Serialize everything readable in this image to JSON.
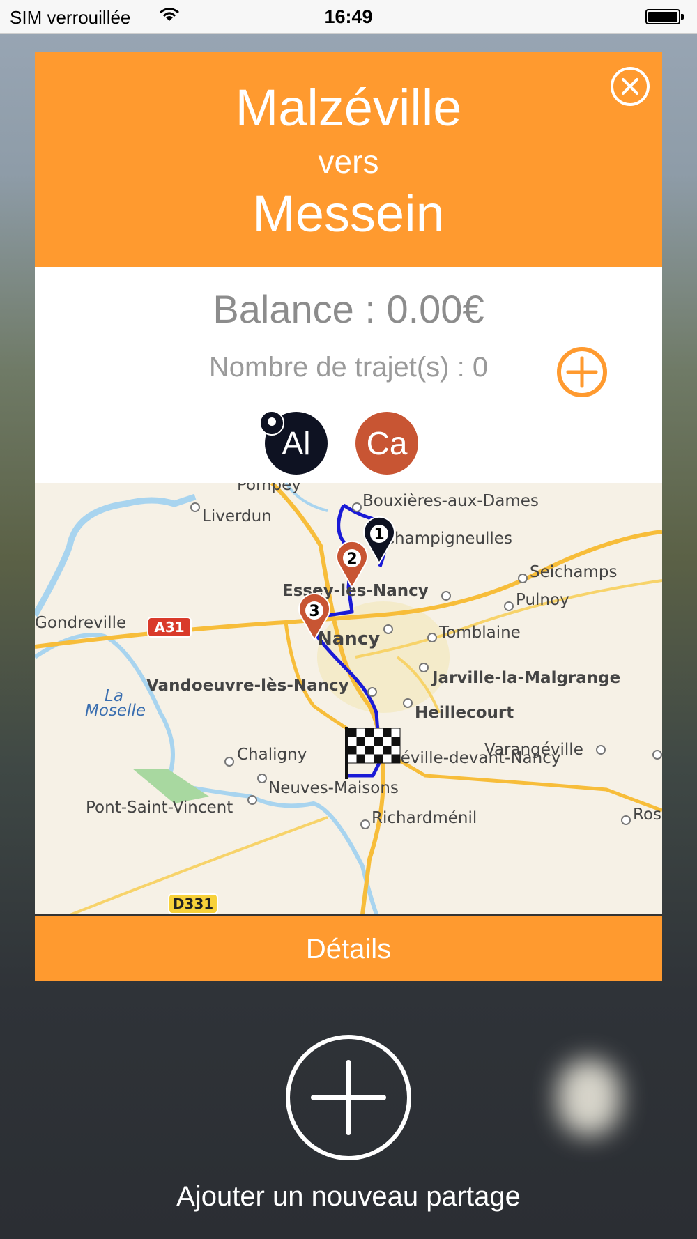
{
  "status_bar": {
    "carrier": "SIM verrouillée",
    "time": "16:49"
  },
  "header": {
    "from": "Malzéville",
    "connector": "vers",
    "to": "Messein"
  },
  "info": {
    "balance": "Balance : 0.00€",
    "trip_count": "Nombre de trajet(s) : 0"
  },
  "participants": [
    {
      "initials": "Al",
      "color": "#0e1222"
    },
    {
      "initials": "Ca",
      "color": "#c85533"
    }
  ],
  "map": {
    "places": {
      "pompey": "Pompey",
      "liverdun": "Liverdun",
      "bouxieres": "Bouxières-aux-Dames",
      "champigneulles": "Champigneulles",
      "seichamps": "Seichamps",
      "essey": "Essey-lès-Nancy",
      "pulnoy": "Pulnoy",
      "gondreville": "Gondreville",
      "nancy": "Nancy",
      "tomblaine": "Tomblaine",
      "jarville": "Jarville-la-Malgrange",
      "vandoeuvre": "Vandoeuvre-lès-Nancy",
      "heillecourt": "Heillecourt",
      "la": "La",
      "moselle": "Moselle",
      "chaligny": "Chaligny",
      "fleville": "Fléville-devant-Nancy",
      "varangeville": "Varangéville",
      "neuves_maisons": "Neuves-Maisons",
      "pont_saint_vincent": "Pont-Saint-Vincent",
      "richardmenil": "Richardménil",
      "rosieres": "Rosières-aux-Salines"
    },
    "roads": {
      "a31": "A31",
      "d331": "D331"
    },
    "markers": [
      "1",
      "2",
      "3"
    ],
    "route_color": "#1a1ad6"
  },
  "details_label": "Détails",
  "add_share_label": "Ajouter un nouveau partage",
  "colors": {
    "accent": "#ff9a2f",
    "white": "#ffffff"
  },
  "icons": {
    "close": "close-circle-icon",
    "add": "plus-circle-icon",
    "finish": "checkered-flag-icon",
    "pin": "map-pin-icon"
  }
}
